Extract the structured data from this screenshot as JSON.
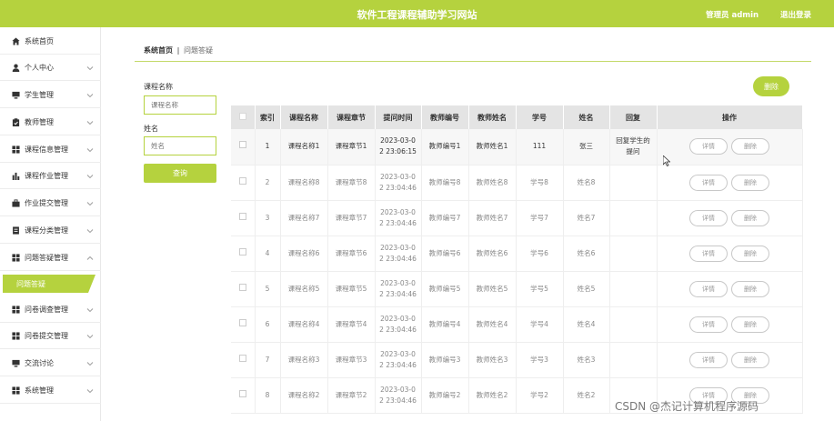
{
  "header": {
    "title": "软件工程课程辅助学习网站",
    "user": "管理员 admin",
    "logout": "退出登录"
  },
  "sidebar": {
    "items": [
      {
        "label": "系统首页",
        "icon": "home-icon",
        "expandable": false
      },
      {
        "label": "个人中心",
        "icon": "user-icon",
        "expandable": true
      },
      {
        "label": "学生管理",
        "icon": "monitor-icon",
        "expandable": true
      },
      {
        "label": "教师管理",
        "icon": "clipboard-icon",
        "expandable": true
      },
      {
        "label": "课程信息管理",
        "icon": "grid-icon",
        "expandable": true
      },
      {
        "label": "课程作业管理",
        "icon": "bar-chart-icon",
        "expandable": true
      },
      {
        "label": "作业提交管理",
        "icon": "briefcase-icon",
        "expandable": true
      },
      {
        "label": "课程分类管理",
        "icon": "document-icon",
        "expandable": true
      },
      {
        "label": "问题答疑管理",
        "icon": "grid-icon",
        "expandable": true,
        "expanded": true
      },
      {
        "label": "问卷调查管理",
        "icon": "grid-icon",
        "expandable": true
      },
      {
        "label": "问卷提交管理",
        "icon": "grid-icon",
        "expandable": true
      },
      {
        "label": "交流讨论",
        "icon": "monitor-icon",
        "expandable": true
      },
      {
        "label": "系统管理",
        "icon": "grid-icon",
        "expandable": true
      }
    ],
    "active_sub": "问题答疑"
  },
  "breadcrumb": {
    "home": "系统首页",
    "separator": "‖",
    "current": "问题答疑"
  },
  "search": {
    "course_label": "课程名称",
    "course_placeholder": "课程名称",
    "name_label": "姓名",
    "name_placeholder": "姓名",
    "button": "查询"
  },
  "actions": {
    "delete": "删除"
  },
  "table": {
    "headers": [
      "",
      "索引",
      "课程名称",
      "课程章节",
      "提问时间",
      "教师编号",
      "教师姓名",
      "学号",
      "姓名",
      "回复",
      "操作"
    ],
    "detail_label": "详情",
    "delete_label": "删除",
    "rows": [
      {
        "index": "1",
        "course": "课程名称1",
        "chapter": "课程章节1",
        "time": "2023-03-0\n2 23:06:15",
        "teacher_id": "教师编号1",
        "teacher_name": "教师姓名1",
        "student_id": "111",
        "name": "张三",
        "reply": "回复学生的\n提问"
      },
      {
        "index": "2",
        "course": "课程名称8",
        "chapter": "课程章节8",
        "time": "2023-03-0\n2 23:04:46",
        "teacher_id": "教师编号8",
        "teacher_name": "教师姓名8",
        "student_id": "学号8",
        "name": "姓名8",
        "reply": ""
      },
      {
        "index": "3",
        "course": "课程名称7",
        "chapter": "课程章节7",
        "time": "2023-03-0\n2 23:04:46",
        "teacher_id": "教师编号7",
        "teacher_name": "教师姓名7",
        "student_id": "学号7",
        "name": "姓名7",
        "reply": ""
      },
      {
        "index": "4",
        "course": "课程名称6",
        "chapter": "课程章节6",
        "time": "2023-03-0\n2 23:04:46",
        "teacher_id": "教师编号6",
        "teacher_name": "教师姓名6",
        "student_id": "学号6",
        "name": "姓名6",
        "reply": ""
      },
      {
        "index": "5",
        "course": "课程名称5",
        "chapter": "课程章节5",
        "time": "2023-03-0\n2 23:04:46",
        "teacher_id": "教师编号5",
        "teacher_name": "教师姓名5",
        "student_id": "学号5",
        "name": "姓名5",
        "reply": ""
      },
      {
        "index": "6",
        "course": "课程名称4",
        "chapter": "课程章节4",
        "time": "2023-03-0\n2 23:04:46",
        "teacher_id": "教师编号4",
        "teacher_name": "教师姓名4",
        "student_id": "学号4",
        "name": "姓名4",
        "reply": ""
      },
      {
        "index": "7",
        "course": "课程名称3",
        "chapter": "课程章节3",
        "time": "2023-03-0\n2 23:04:46",
        "teacher_id": "教师编号3",
        "teacher_name": "教师姓名3",
        "student_id": "学号3",
        "name": "姓名3",
        "reply": ""
      },
      {
        "index": "8",
        "course": "课程名称2",
        "chapter": "课程章节2",
        "time": "2023-03-0\n2 23:04:46",
        "teacher_id": "教师编号2",
        "teacher_name": "教师姓名2",
        "student_id": "学号2",
        "name": "姓名2",
        "reply": ""
      }
    ]
  },
  "watermark": "CSDN @杰记计算机程序源码",
  "colors": {
    "accent": "#b5d23e",
    "header_bg": "#e4e4e4"
  }
}
